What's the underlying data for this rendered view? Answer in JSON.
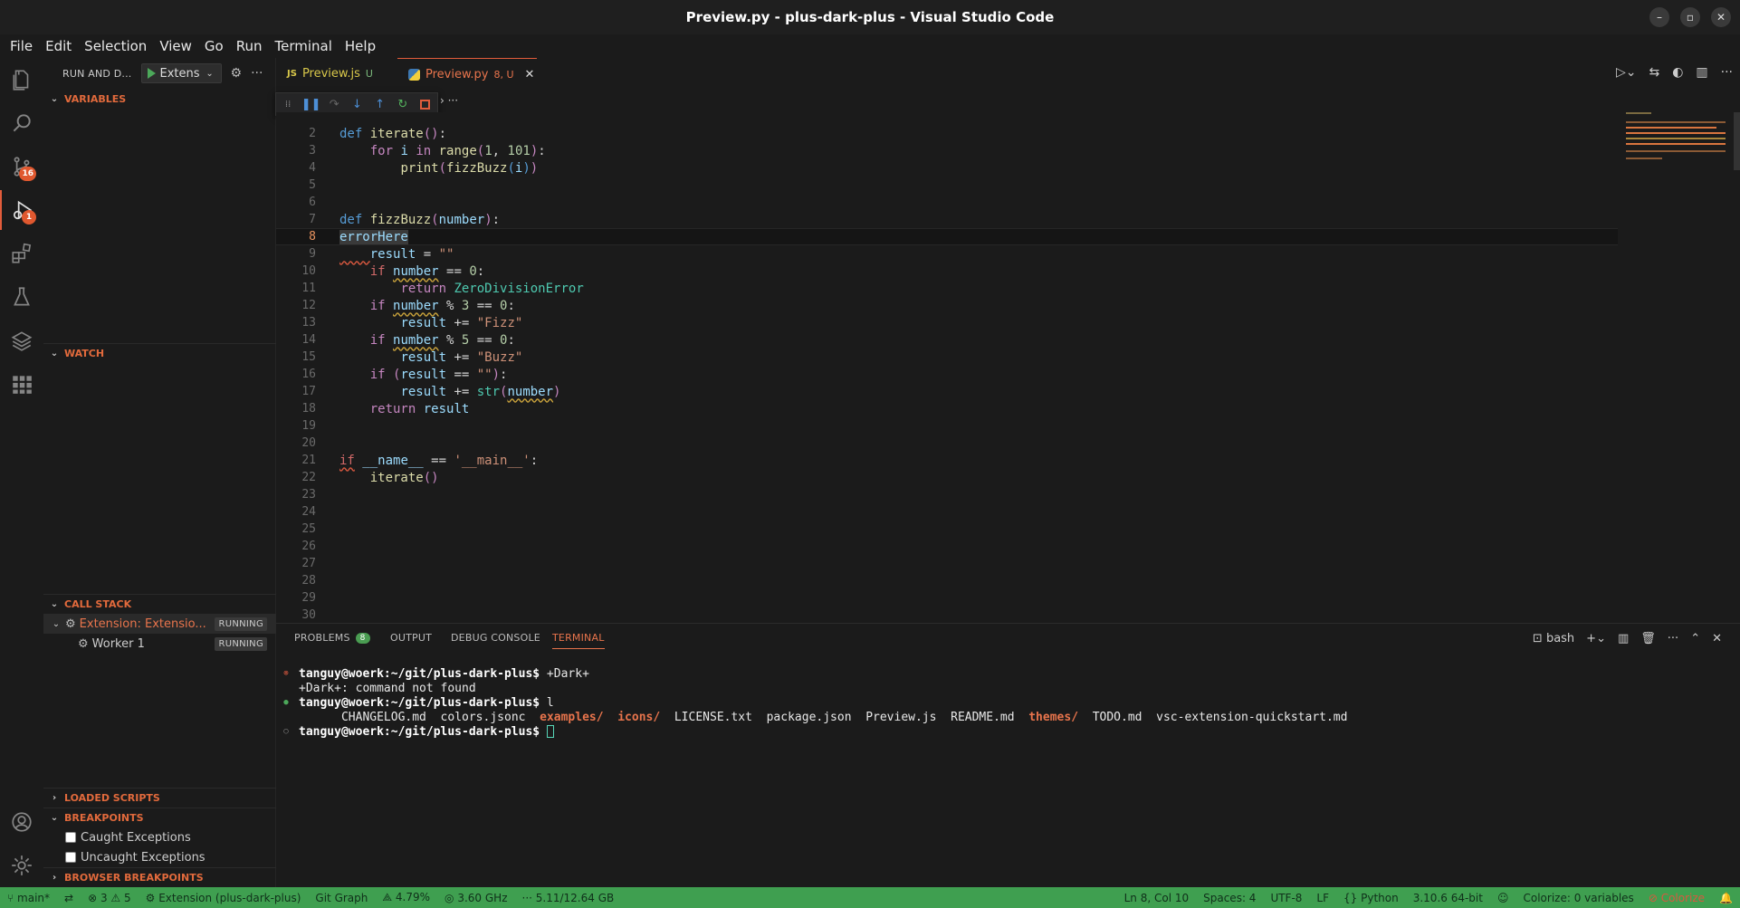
{
  "window": {
    "title": "Preview.py - plus-dark-plus - Visual Studio Code",
    "buttons": [
      "–",
      "▫",
      "✕"
    ]
  },
  "menu": [
    "File",
    "Edit",
    "Selection",
    "View",
    "Go",
    "Run",
    "Terminal",
    "Help"
  ],
  "activity": {
    "scm_badge": "16",
    "debug_badge": "1"
  },
  "sidebar": {
    "title": "RUN AND D...",
    "config": "Extens",
    "sections": {
      "variables": "VARIABLES",
      "watch": "WATCH",
      "callstack": "CALL STACK",
      "loaded": "LOADED SCRIPTS",
      "breakpoints": "BREAKPOINTS",
      "browser": "BROWSER BREAKPOINTS"
    },
    "callstack": [
      {
        "name": "Extension: Extensio...",
        "status": "RUNNING"
      },
      {
        "name": "Worker 1",
        "status": "RUNNING"
      }
    ],
    "breakpoints": [
      "Caught Exceptions",
      "Uncaught Exceptions"
    ]
  },
  "tabs": [
    {
      "icon": "JS",
      "label": "Preview.js",
      "suffix": "U"
    },
    {
      "label": "Preview.py",
      "suffix": "8, U",
      "close": "✕"
    }
  ],
  "editor": {
    "line_numbers": [
      "2",
      "3",
      "4",
      "5",
      "6",
      "7",
      "8",
      "9",
      "10",
      "11",
      "12",
      "13",
      "14",
      "15",
      "16",
      "17",
      "18",
      "19",
      "20",
      "21",
      "22",
      "23",
      "24",
      "25",
      "26",
      "27",
      "28",
      "29",
      "30"
    ],
    "current_line": "8"
  },
  "panel": {
    "tabs": [
      "PROBLEMS",
      "OUTPUT",
      "DEBUG CONSOLE",
      "TERMINAL"
    ],
    "problems_count": "8",
    "shell": "bash",
    "terminal": {
      "prompt": "tanguy@woerk:~/git/plus-dark-plus$",
      "cmd1": " +Dark+",
      "err": "+Dark+: command not found",
      "cmd2": " l",
      "files": [
        "CHANGELOG.md",
        "colors.jsonc",
        "examples/",
        "icons/",
        "LICENSE.txt",
        "package.json",
        "Preview.js",
        "README.md",
        "themes/",
        "TODO.md",
        "vsc-extension-quickstart.md"
      ]
    }
  },
  "status": {
    "branch": "main*",
    "errors": "⊗ 3 ⚠ 5",
    "ext": "Extension (plus-dark-plus)",
    "git": "Git Graph",
    "cpu": "4.79%",
    "freq": "3.60 GHz",
    "mem": "5.11/12.64 GB",
    "pos": "Ln 8, Col 10",
    "spaces": "Spaces: 4",
    "enc": "UTF-8",
    "eol": "LF",
    "lang": "Python",
    "interp": "3.10.6 64-bit",
    "colorize": "Colorize: 0 variables",
    "colorize2": "Colorize"
  },
  "colors": {
    "accent": "#e25c3b",
    "status": "#3f9f50"
  }
}
